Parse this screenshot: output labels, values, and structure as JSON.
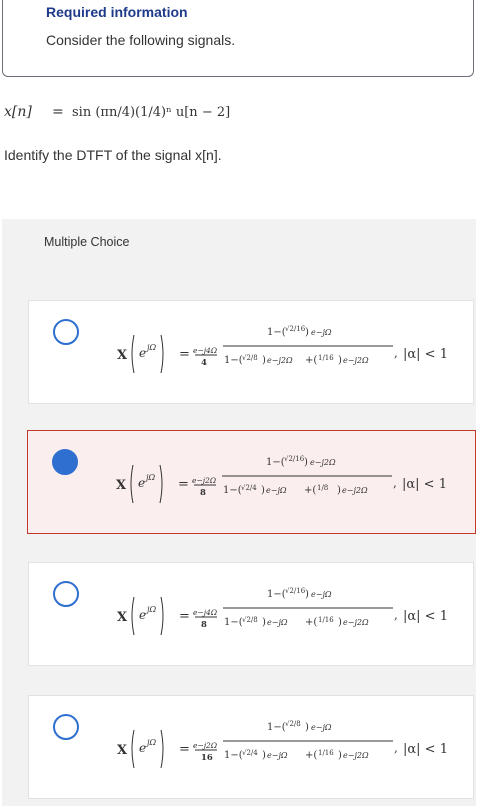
{
  "info": {
    "title": "Required information",
    "text": "Consider the following signals."
  },
  "signal": {
    "lhs": "x[n]",
    "eq": "=",
    "rhs": "sin (πn/4)(1/4)ⁿ u[n − 2]"
  },
  "question": "Identify the DTFT of the signal x[n].",
  "multiple_choice": {
    "label": "Multiple Choice",
    "options": [
      {
        "selected": false,
        "prefix_exp": "e−j4Ω",
        "prefix_den": "4",
        "num_coef": "√2/16",
        "num_exp": "e−jΩ",
        "den_coef1": "√2/8",
        "den_exp1": "e−j2Ω",
        "den_coef2": "1/16",
        "den_exp2": "e−j2Ω",
        "condition": "|α| < 1"
      },
      {
        "selected": true,
        "prefix_exp": "e−j2Ω",
        "prefix_den": "8",
        "num_coef": "√2/16",
        "num_exp": "e−j2Ω",
        "den_coef1": "√2/4",
        "den_exp1": "e−jΩ",
        "den_coef2": "1/8",
        "den_exp2": "e−j2Ω",
        "condition": "|α| < 1"
      },
      {
        "selected": false,
        "prefix_exp": "e−j4Ω",
        "prefix_den": "8",
        "num_coef": "√2/16",
        "num_exp": "e−jΩ",
        "den_coef1": "√2/8",
        "den_exp1": "e−jΩ",
        "den_coef2": "1/16",
        "den_exp2": "e−j2Ω",
        "condition": "|α| < 1"
      },
      {
        "selected": false,
        "prefix_exp": "e−j2Ω",
        "prefix_den": "16",
        "num_coef": "√2/8",
        "num_exp": "e−jΩ",
        "den_coef1": "√2/4",
        "den_exp1": "e−jΩ",
        "den_coef2": "1/16",
        "den_exp2": "e−j2Ω",
        "condition": "|α| < 1"
      }
    ]
  },
  "colors": {
    "accent": "#2f6fd0",
    "title": "#1f3a8a",
    "selected_border": "#c0392b",
    "selected_bg": "#fbeeee",
    "panel_bg": "#f2f2f2"
  }
}
